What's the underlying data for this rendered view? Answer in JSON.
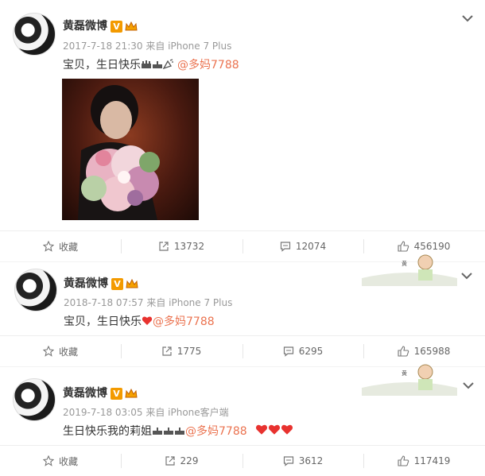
{
  "posts": [
    {
      "username": "黄磊微博",
      "vip_badge": "V",
      "timestamp": "2017-7-18 21:30",
      "source": "来自 iPhone 7 Plus",
      "text": "宝贝，生日快乐",
      "mention": "@多妈7788",
      "actions": {
        "favorite": "收藏",
        "repost": "13732",
        "comment": "12074",
        "like": "456190"
      }
    },
    {
      "username": "黄磊微博",
      "vip_badge": "V",
      "timestamp": "2018-7-18 07:57",
      "source": "来自 iPhone 7 Plus",
      "text": "宝贝，生日快乐",
      "mention": "@多妈7788",
      "actions": {
        "favorite": "收藏",
        "repost": "1775",
        "comment": "6295",
        "like": "165988"
      }
    },
    {
      "username": "黄磊微博",
      "vip_badge": "V",
      "timestamp": "2019-7-18 03:05",
      "source": "来自 iPhone客户端",
      "text": "生日快乐我的莉姐",
      "mention": "@多妈7788",
      "actions": {
        "favorite": "收藏",
        "repost": "229",
        "comment": "3612",
        "like": "117419"
      }
    }
  ],
  "colors": {
    "mention": "#eb7350",
    "badge": "#f39a00",
    "heart": "#e8322f"
  },
  "icons": [
    "star-icon",
    "repost-icon",
    "comment-icon",
    "like-icon",
    "chevron-down-icon",
    "heart-icon",
    "cake-icon",
    "crown-icon"
  ]
}
